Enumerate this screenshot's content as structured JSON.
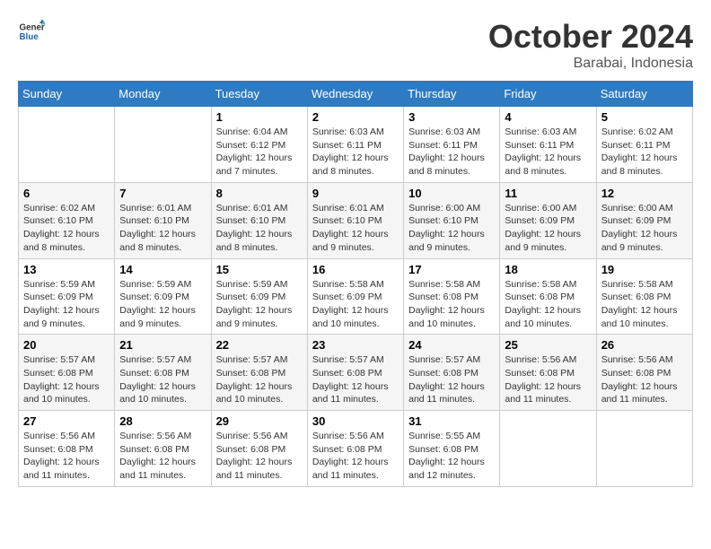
{
  "header": {
    "logo_general": "General",
    "logo_blue": "Blue",
    "month_title": "October 2024",
    "location": "Barabai, Indonesia"
  },
  "days_of_week": [
    "Sunday",
    "Monday",
    "Tuesday",
    "Wednesday",
    "Thursday",
    "Friday",
    "Saturday"
  ],
  "weeks": [
    [
      {
        "day": "",
        "sunrise": "",
        "sunset": "",
        "daylight": ""
      },
      {
        "day": "",
        "sunrise": "",
        "sunset": "",
        "daylight": ""
      },
      {
        "day": "1",
        "sunrise": "Sunrise: 6:04 AM",
        "sunset": "Sunset: 6:12 PM",
        "daylight": "Daylight: 12 hours and 7 minutes."
      },
      {
        "day": "2",
        "sunrise": "Sunrise: 6:03 AM",
        "sunset": "Sunset: 6:11 PM",
        "daylight": "Daylight: 12 hours and 8 minutes."
      },
      {
        "day": "3",
        "sunrise": "Sunrise: 6:03 AM",
        "sunset": "Sunset: 6:11 PM",
        "daylight": "Daylight: 12 hours and 8 minutes."
      },
      {
        "day": "4",
        "sunrise": "Sunrise: 6:03 AM",
        "sunset": "Sunset: 6:11 PM",
        "daylight": "Daylight: 12 hours and 8 minutes."
      },
      {
        "day": "5",
        "sunrise": "Sunrise: 6:02 AM",
        "sunset": "Sunset: 6:11 PM",
        "daylight": "Daylight: 12 hours and 8 minutes."
      }
    ],
    [
      {
        "day": "6",
        "sunrise": "Sunrise: 6:02 AM",
        "sunset": "Sunset: 6:10 PM",
        "daylight": "Daylight: 12 hours and 8 minutes."
      },
      {
        "day": "7",
        "sunrise": "Sunrise: 6:01 AM",
        "sunset": "Sunset: 6:10 PM",
        "daylight": "Daylight: 12 hours and 8 minutes."
      },
      {
        "day": "8",
        "sunrise": "Sunrise: 6:01 AM",
        "sunset": "Sunset: 6:10 PM",
        "daylight": "Daylight: 12 hours and 8 minutes."
      },
      {
        "day": "9",
        "sunrise": "Sunrise: 6:01 AM",
        "sunset": "Sunset: 6:10 PM",
        "daylight": "Daylight: 12 hours and 9 minutes."
      },
      {
        "day": "10",
        "sunrise": "Sunrise: 6:00 AM",
        "sunset": "Sunset: 6:10 PM",
        "daylight": "Daylight: 12 hours and 9 minutes."
      },
      {
        "day": "11",
        "sunrise": "Sunrise: 6:00 AM",
        "sunset": "Sunset: 6:09 PM",
        "daylight": "Daylight: 12 hours and 9 minutes."
      },
      {
        "day": "12",
        "sunrise": "Sunrise: 6:00 AM",
        "sunset": "Sunset: 6:09 PM",
        "daylight": "Daylight: 12 hours and 9 minutes."
      }
    ],
    [
      {
        "day": "13",
        "sunrise": "Sunrise: 5:59 AM",
        "sunset": "Sunset: 6:09 PM",
        "daylight": "Daylight: 12 hours and 9 minutes."
      },
      {
        "day": "14",
        "sunrise": "Sunrise: 5:59 AM",
        "sunset": "Sunset: 6:09 PM",
        "daylight": "Daylight: 12 hours and 9 minutes."
      },
      {
        "day": "15",
        "sunrise": "Sunrise: 5:59 AM",
        "sunset": "Sunset: 6:09 PM",
        "daylight": "Daylight: 12 hours and 9 minutes."
      },
      {
        "day": "16",
        "sunrise": "Sunrise: 5:58 AM",
        "sunset": "Sunset: 6:09 PM",
        "daylight": "Daylight: 12 hours and 10 minutes."
      },
      {
        "day": "17",
        "sunrise": "Sunrise: 5:58 AM",
        "sunset": "Sunset: 6:08 PM",
        "daylight": "Daylight: 12 hours and 10 minutes."
      },
      {
        "day": "18",
        "sunrise": "Sunrise: 5:58 AM",
        "sunset": "Sunset: 6:08 PM",
        "daylight": "Daylight: 12 hours and 10 minutes."
      },
      {
        "day": "19",
        "sunrise": "Sunrise: 5:58 AM",
        "sunset": "Sunset: 6:08 PM",
        "daylight": "Daylight: 12 hours and 10 minutes."
      }
    ],
    [
      {
        "day": "20",
        "sunrise": "Sunrise: 5:57 AM",
        "sunset": "Sunset: 6:08 PM",
        "daylight": "Daylight: 12 hours and 10 minutes."
      },
      {
        "day": "21",
        "sunrise": "Sunrise: 5:57 AM",
        "sunset": "Sunset: 6:08 PM",
        "daylight": "Daylight: 12 hours and 10 minutes."
      },
      {
        "day": "22",
        "sunrise": "Sunrise: 5:57 AM",
        "sunset": "Sunset: 6:08 PM",
        "daylight": "Daylight: 12 hours and 10 minutes."
      },
      {
        "day": "23",
        "sunrise": "Sunrise: 5:57 AM",
        "sunset": "Sunset: 6:08 PM",
        "daylight": "Daylight: 12 hours and 11 minutes."
      },
      {
        "day": "24",
        "sunrise": "Sunrise: 5:57 AM",
        "sunset": "Sunset: 6:08 PM",
        "daylight": "Daylight: 12 hours and 11 minutes."
      },
      {
        "day": "25",
        "sunrise": "Sunrise: 5:56 AM",
        "sunset": "Sunset: 6:08 PM",
        "daylight": "Daylight: 12 hours and 11 minutes."
      },
      {
        "day": "26",
        "sunrise": "Sunrise: 5:56 AM",
        "sunset": "Sunset: 6:08 PM",
        "daylight": "Daylight: 12 hours and 11 minutes."
      }
    ],
    [
      {
        "day": "27",
        "sunrise": "Sunrise: 5:56 AM",
        "sunset": "Sunset: 6:08 PM",
        "daylight": "Daylight: 12 hours and 11 minutes."
      },
      {
        "day": "28",
        "sunrise": "Sunrise: 5:56 AM",
        "sunset": "Sunset: 6:08 PM",
        "daylight": "Daylight: 12 hours and 11 minutes."
      },
      {
        "day": "29",
        "sunrise": "Sunrise: 5:56 AM",
        "sunset": "Sunset: 6:08 PM",
        "daylight": "Daylight: 12 hours and 11 minutes."
      },
      {
        "day": "30",
        "sunrise": "Sunrise: 5:56 AM",
        "sunset": "Sunset: 6:08 PM",
        "daylight": "Daylight: 12 hours and 11 minutes."
      },
      {
        "day": "31",
        "sunrise": "Sunrise: 5:55 AM",
        "sunset": "Sunset: 6:08 PM",
        "daylight": "Daylight: 12 hours and 12 minutes."
      },
      {
        "day": "",
        "sunrise": "",
        "sunset": "",
        "daylight": ""
      },
      {
        "day": "",
        "sunrise": "",
        "sunset": "",
        "daylight": ""
      }
    ]
  ]
}
